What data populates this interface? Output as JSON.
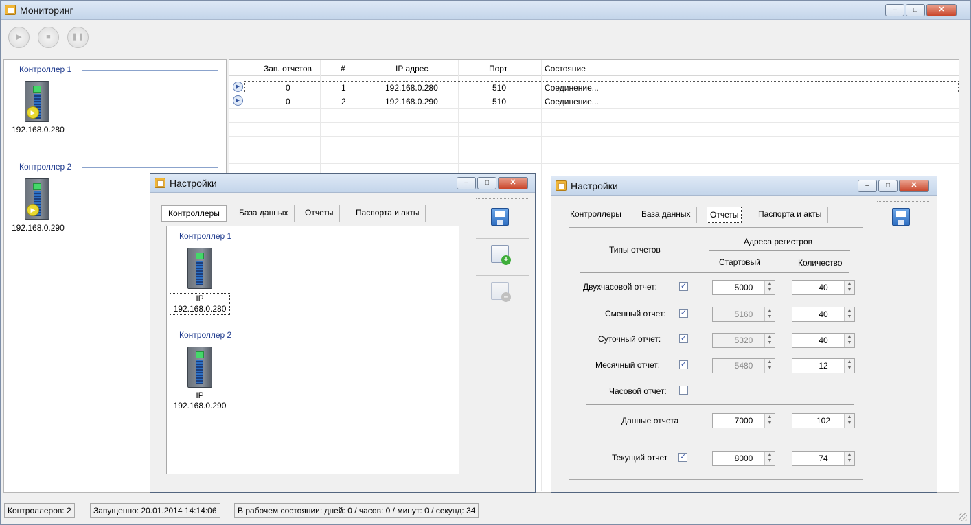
{
  "main_window": {
    "title": "Мониторинг",
    "controls": {
      "minimize": "–",
      "maximize": "□",
      "close": "✕"
    },
    "toolbar": {
      "start_icon": "▶",
      "stop_icon": "■",
      "pause_icon": "❚❚"
    }
  },
  "left_panel": {
    "groups": [
      {
        "label": "Контроллер 1",
        "ip": "192.168.0.280"
      },
      {
        "label": "Контроллер 2",
        "ip": "192.168.0.290"
      }
    ]
  },
  "table": {
    "columns": [
      "Зап. отчетов",
      "#",
      "IP адрес",
      "Порт",
      "Состояние"
    ],
    "rows": [
      {
        "reports": "0",
        "num": "1",
        "ip": "192.168.0.280",
        "port": "510",
        "status": "Соединение..."
      },
      {
        "reports": "0",
        "num": "2",
        "ip": "192.168.0.290",
        "port": "510",
        "status": "Соединение..."
      }
    ]
  },
  "settings_left": {
    "title": "Настройки",
    "tabs": [
      "Контроллеры",
      "База данных",
      "Отчеты",
      "Паспорта и акты"
    ],
    "selected_tab": "Контроллеры",
    "controllers": [
      {
        "label": "Контроллер 1",
        "ip_label": "IP",
        "ip": "192.168.0.280"
      },
      {
        "label": "Контроллер 2",
        "ip_label": "IP",
        "ip": "192.168.0.290"
      }
    ]
  },
  "settings_right": {
    "title": "Настройки",
    "tabs": [
      "Контроллеры",
      "База данных",
      "Отчеты",
      "Паспорта и акты"
    ],
    "selected_tab": "Отчеты",
    "header": {
      "types": "Типы отчетов",
      "addresses": "Адреса регистров",
      "start": "Стартовый",
      "count": "Количество"
    },
    "reports": [
      {
        "label": "Двухчасовой отчет:",
        "checked": true,
        "start": "5000",
        "start_enabled": true,
        "count": "40"
      },
      {
        "label": "Сменный отчет:",
        "checked": true,
        "start": "5160",
        "start_enabled": false,
        "count": "40"
      },
      {
        "label": "Суточный отчет:",
        "checked": true,
        "start": "5320",
        "start_enabled": false,
        "count": "40"
      },
      {
        "label": "Месячный отчет:",
        "checked": true,
        "start": "5480",
        "start_enabled": false,
        "count": "12"
      },
      {
        "label": "Часовой отчет:",
        "checked": false
      }
    ],
    "data_row": {
      "label": "Данные отчета",
      "start": "7000",
      "count": "102"
    },
    "current_row": {
      "label": "Текущий отчет",
      "checked": true,
      "start": "8000",
      "count": "74"
    }
  },
  "status_bar": {
    "controllers": "Контроллеров: 2",
    "started": "Запущенно: 20.01.2014 14:14:06",
    "uptime": "В рабочем состоянии: дней: 0 / часов: 0 / минут: 0 / секунд: 34"
  },
  "glyphs": {
    "check": "✓",
    "up": "▲",
    "down": "▼",
    "row_play": "▶"
  }
}
